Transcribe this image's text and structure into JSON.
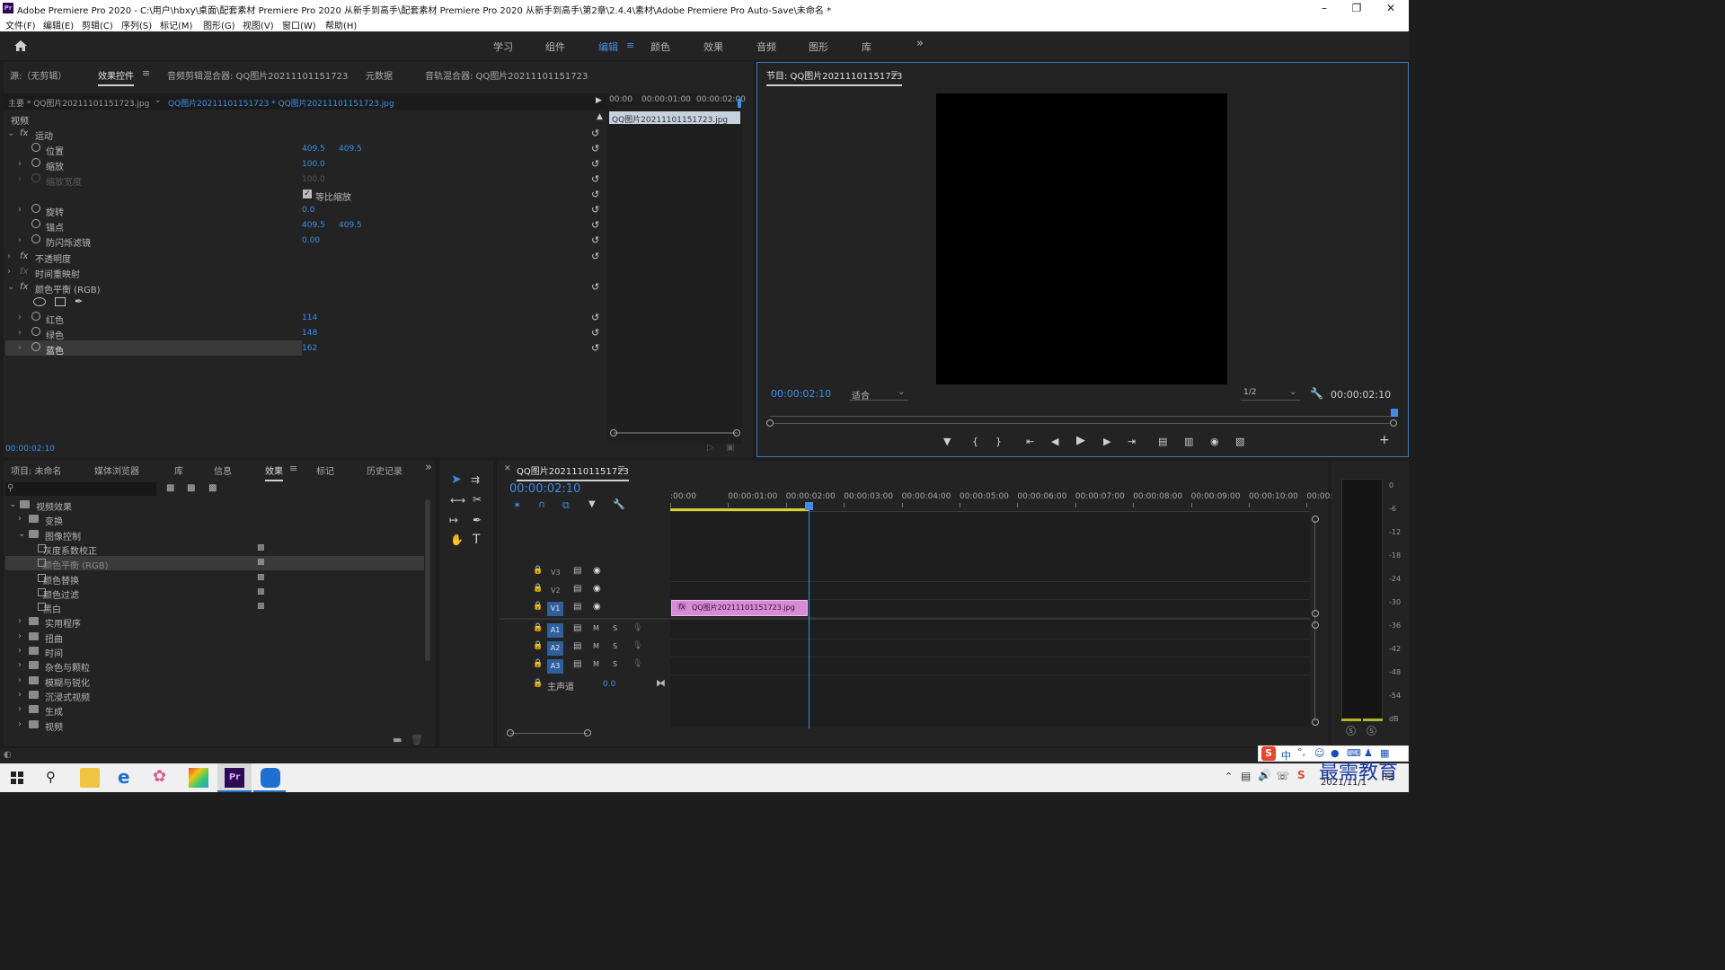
{
  "window": {
    "title": "Adobe Premiere Pro 2020 - C:\\用户\\hbxy\\桌面\\配套素材 Premiere Pro 2020 从新手到高手\\配套素材 Premiere Pro 2020 从新手到高手\\第2章\\2.4.4\\素材\\Adobe Premiere Pro Auto-Save\\未命名 *",
    "logo": "Pr"
  },
  "menu": [
    "文件(F)",
    "编辑(E)",
    "剪辑(C)",
    "序列(S)",
    "标记(M)",
    "图形(G)",
    "视图(V)",
    "窗口(W)",
    "帮助(H)"
  ],
  "workspaces": [
    "学习",
    "组件",
    "编辑",
    "颜色",
    "效果",
    "音频",
    "图形",
    "库"
  ],
  "active_workspace": "编辑",
  "source_tabs": [
    "源:（无剪辑）",
    "效果控件",
    "音频剪辑混合器: QQ图片20211101151723",
    "元数据",
    "音轨混合器: QQ图片20211101151723"
  ],
  "effect_controls": {
    "master_clip": "主要 * QQ图片20211101151723.jpg",
    "sequence_clip": "QQ图片20211101151723 * QQ图片20211101151723.jpg",
    "section": "视频",
    "mini_ruler": [
      "00:00",
      "00:00:01:00",
      "00:00:02:00"
    ],
    "mini_clip": "QQ图片20211101151723.jpg",
    "rows": {
      "motion": "运动",
      "position": "位置",
      "position_x": "409.5",
      "position_y": "409.5",
      "scale": "缩放",
      "scale_v": "100.0",
      "scale_width": "缩放宽度",
      "scale_width_v": "100.0",
      "uniform": "等比缩放",
      "rotation": "旋转",
      "rotation_v": "0.0",
      "anchor": "锚点",
      "anchor_x": "409.5",
      "anchor_y": "409.5",
      "flicker": "防闪烁滤镜",
      "flicker_v": "0.00",
      "opacity": "不透明度",
      "time_remap": "时间重映射",
      "color_balance": "颜色平衡 (RGB)",
      "red": "红色",
      "red_v": "114",
      "green": "绿色",
      "green_v": "148",
      "blue": "蓝色",
      "blue_v": "162"
    },
    "timecode": "00:00:02:10"
  },
  "program": {
    "title": "节目: QQ图片20211101151723",
    "timecode_left": "00:00:02:10",
    "fit": "适合",
    "resolution": "1/2",
    "timecode_right": "00:00:02:10"
  },
  "project_tabs": [
    "项目: 未命名",
    "媒体浏览器",
    "库",
    "信息",
    "效果",
    "标记",
    "历史记录"
  ],
  "effects_tree": [
    {
      "label": "视频效果",
      "level": 0,
      "type": "folder",
      "open": true
    },
    {
      "label": "变换",
      "level": 1,
      "type": "folder"
    },
    {
      "label": "图像控制",
      "level": 1,
      "type": "folder",
      "open": true
    },
    {
      "label": "灰度系数校正",
      "level": 2,
      "type": "effect"
    },
    {
      "label": "颜色平衡 (RGB)",
      "level": 2,
      "type": "effect",
      "selected": true
    },
    {
      "label": "颜色替换",
      "level": 2,
      "type": "effect"
    },
    {
      "label": "颜色过滤",
      "level": 2,
      "type": "effect"
    },
    {
      "label": "黑白",
      "level": 2,
      "type": "effect"
    },
    {
      "label": "实用程序",
      "level": 1,
      "type": "folder"
    },
    {
      "label": "扭曲",
      "level": 1,
      "type": "folder"
    },
    {
      "label": "时间",
      "level": 1,
      "type": "folder"
    },
    {
      "label": "杂色与颗粒",
      "level": 1,
      "type": "folder"
    },
    {
      "label": "模糊与锐化",
      "level": 1,
      "type": "folder"
    },
    {
      "label": "沉浸式视频",
      "level": 1,
      "type": "folder"
    },
    {
      "label": "生成",
      "level": 1,
      "type": "folder"
    },
    {
      "label": "视频",
      "level": 1,
      "type": "folder"
    }
  ],
  "timeline": {
    "tab": "QQ图片20211101151723",
    "timecode": "00:00:02:10",
    "ruler": [
      ":00:00",
      "00:00:01:00",
      "00:00:02:00",
      "00:00:03:00",
      "00:00:04:00",
      "00:00:05:00",
      "00:00:06:00",
      "00:00:07:00",
      "00:00:08:00",
      "00:00:09:00",
      "00:00:10:00",
      "00:00:1"
    ],
    "tracks": [
      "V3",
      "V2",
      "V1",
      "A1",
      "A2",
      "A3"
    ],
    "master": "主声道",
    "master_value": "0.0",
    "clip": "QQ图片20211101151723.jpg",
    "clip_fx": "fx"
  },
  "meter_labels": [
    "0",
    "-6",
    "-12",
    "-18",
    "-24",
    "-30",
    "-36",
    "-42",
    "-48",
    "-54",
    "dB"
  ],
  "meter_solo": [
    "S",
    "S"
  ],
  "tray": {
    "ime": "中",
    "date": "2021/11/1",
    "watermark": "最需教育"
  },
  "colors": {
    "accent": "#3d8ee8",
    "clip": "#d98ad6",
    "playhead": "#3d8ee8"
  }
}
